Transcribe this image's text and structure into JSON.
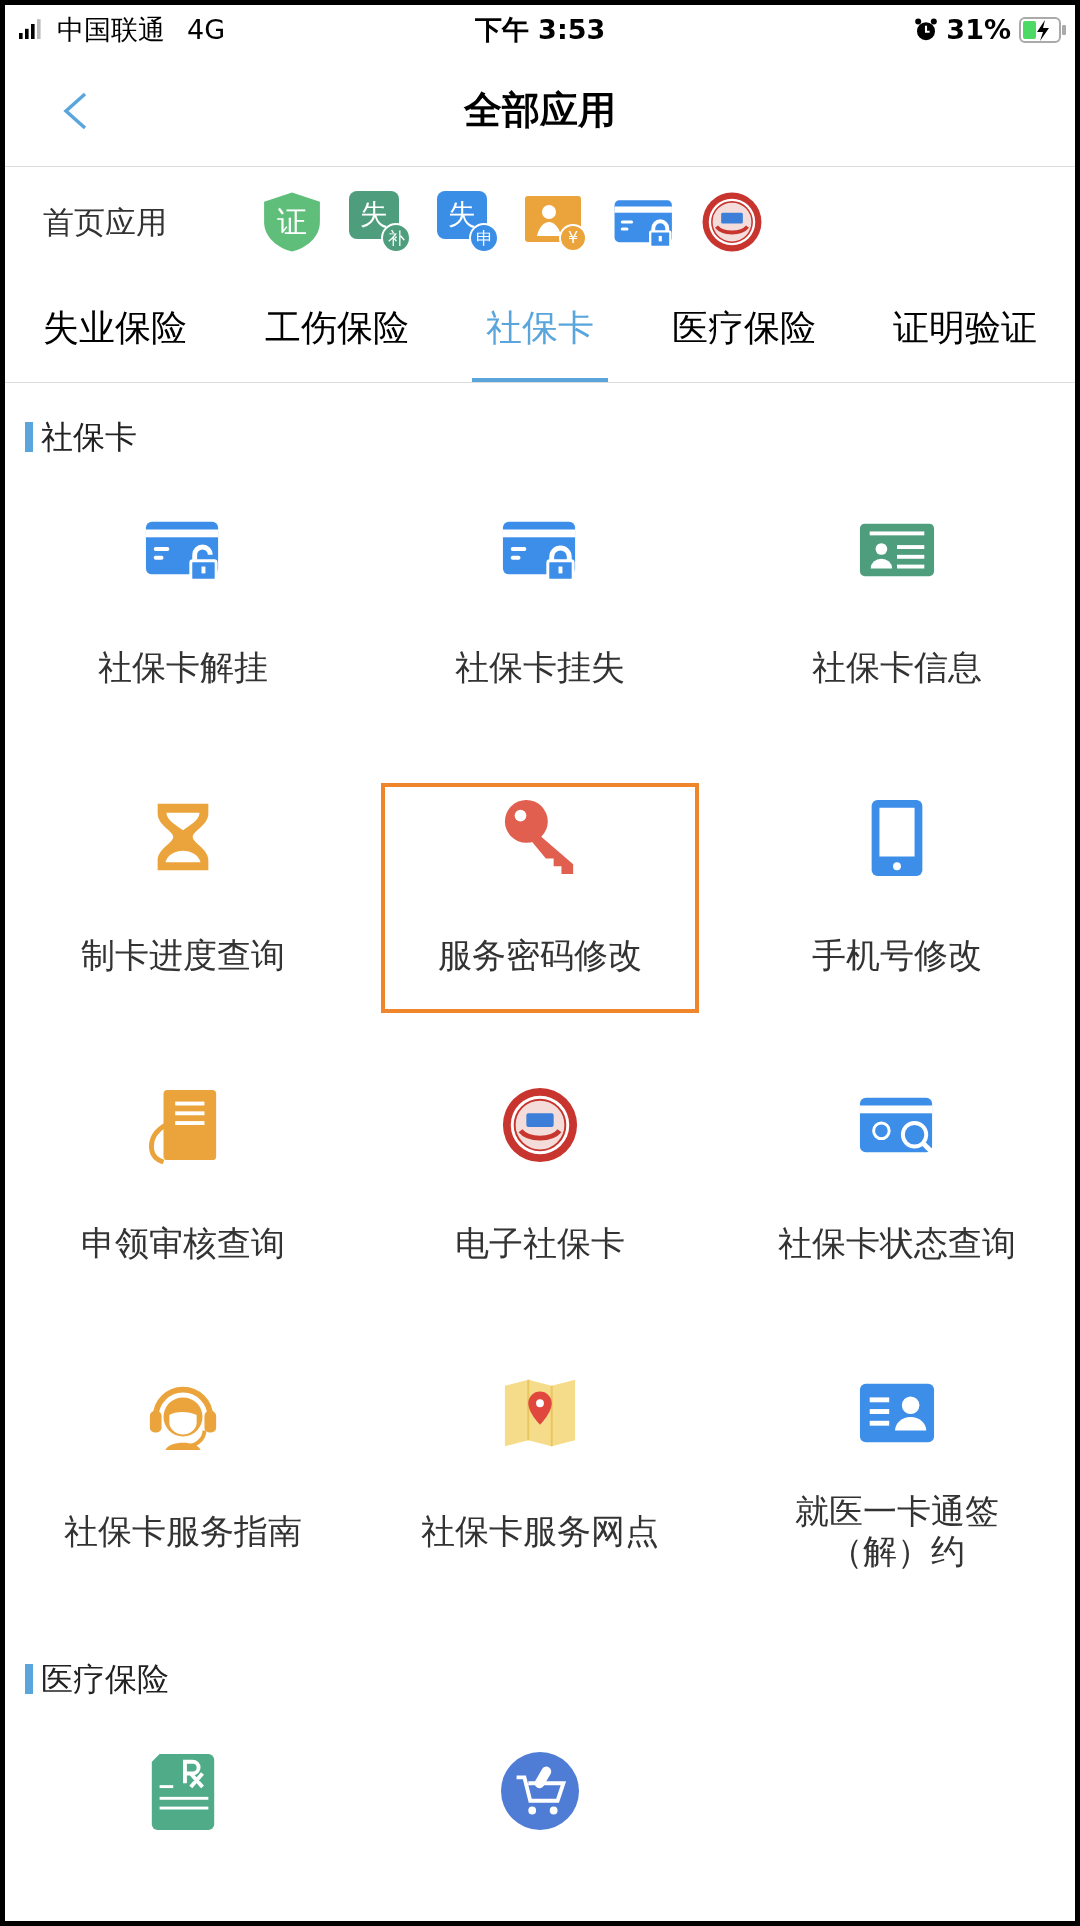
{
  "status_bar": {
    "carrier": "中国联通",
    "network": "4G",
    "time": "下午 3:53",
    "battery": "31%"
  },
  "nav": {
    "title": "全部应用"
  },
  "home_apps": {
    "label": "首页应用",
    "icons": [
      {
        "kind": "shield",
        "glyph": "证"
      },
      {
        "kind": "badge",
        "glyph": "失",
        "sub": "补",
        "color": "#4e9e7e"
      },
      {
        "kind": "badge",
        "glyph": "失",
        "sub": "申",
        "color": "#3b8ee6"
      },
      {
        "kind": "person-money",
        "glyph": "¥"
      },
      {
        "kind": "card-lock"
      },
      {
        "kind": "emblem"
      }
    ]
  },
  "tabs": [
    {
      "label": "失业保险",
      "selected": false
    },
    {
      "label": "工伤保险",
      "selected": false
    },
    {
      "label": "社保卡",
      "selected": true
    },
    {
      "label": "医疗保险",
      "selected": false
    },
    {
      "label": "证明验证",
      "selected": false
    }
  ],
  "sections": [
    {
      "title": "社保卡",
      "items": [
        {
          "kind": "card-unlock",
          "label": "社保卡解挂",
          "highlighted": false
        },
        {
          "kind": "card-lock",
          "label": "社保卡挂失",
          "highlighted": false
        },
        {
          "kind": "id-card",
          "label": "社保卡信息",
          "highlighted": false
        },
        {
          "kind": "hourglass",
          "label": "制卡进度查询",
          "highlighted": false
        },
        {
          "kind": "key",
          "label": "服务密码修改",
          "highlighted": true
        },
        {
          "kind": "phone",
          "label": "手机号修改",
          "highlighted": false
        },
        {
          "kind": "doc-hand",
          "label": "申领审核查询",
          "highlighted": false
        },
        {
          "kind": "emblem",
          "label": "电子社保卡",
          "highlighted": false
        },
        {
          "kind": "card-search",
          "label": "社保卡状态查询",
          "highlighted": false
        },
        {
          "kind": "headset",
          "label": "社保卡服务指南",
          "highlighted": false
        },
        {
          "kind": "map-pin",
          "label": "社保卡服务网点",
          "highlighted": false
        },
        {
          "kind": "contact-card",
          "label_lines": [
            "就医一卡通签",
            "（解）约"
          ],
          "highlighted": false
        }
      ]
    },
    {
      "title": "医疗保险",
      "items": [
        {
          "kind": "rx-doc",
          "highlighted": false
        },
        {
          "kind": "cart",
          "highlighted": false
        }
      ]
    }
  ]
}
